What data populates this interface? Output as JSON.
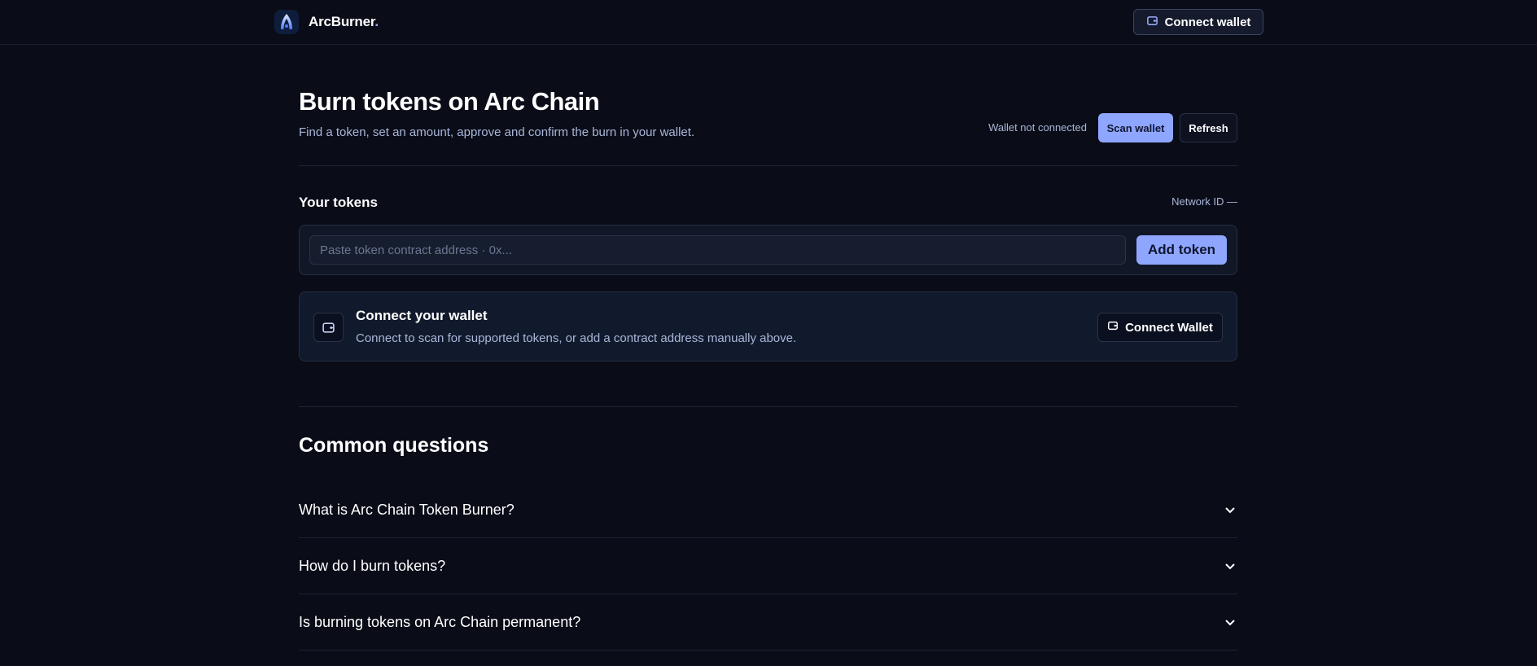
{
  "header": {
    "brand_name": "ArcBurner",
    "brand_suffix": ".",
    "connect_label": "Connect wallet"
  },
  "hero": {
    "title": "Burn tokens on Arc Chain",
    "subtitle": "Find a token, set an amount, approve and confirm the burn in your wallet.",
    "wallet_status": "Wallet not connected",
    "scan_label": "Scan wallet",
    "refresh_label": "Refresh"
  },
  "tokens": {
    "section_title": "Your tokens",
    "network_label": "Network ID —",
    "input_placeholder": "Paste token contract address · 0x...",
    "add_label": "Add token"
  },
  "connect_card": {
    "title": "Connect your wallet",
    "description": "Connect to scan for supported tokens, or add a contract address manually above.",
    "button_label": "Connect Wallet"
  },
  "faq": {
    "title": "Common questions",
    "items": [
      {
        "question": "What is Arc Chain Token Burner?"
      },
      {
        "question": "How do I burn tokens?"
      },
      {
        "question": "Is burning tokens on Arc Chain permanent?"
      }
    ]
  },
  "colors": {
    "background": "#0a0d18",
    "accent": "#8ea6ff",
    "muted_text": "#a9b6d8"
  },
  "icons": {
    "logo": "arc-logo-icon",
    "wallet": "wallet-icon",
    "chevron": "chevron-down-icon"
  }
}
